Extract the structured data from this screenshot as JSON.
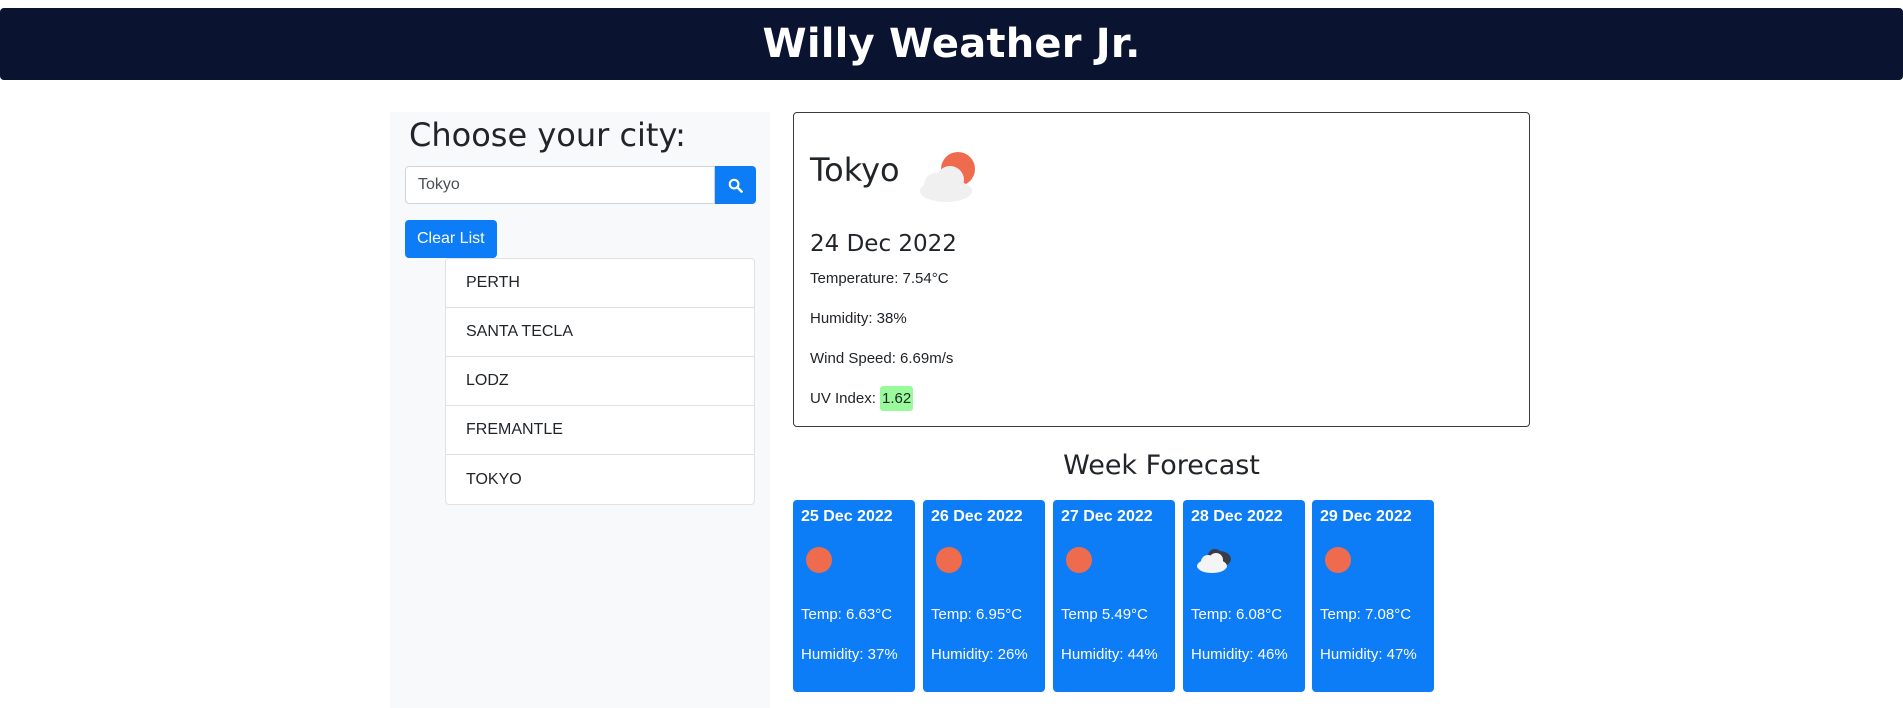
{
  "header": {
    "title": "Willy Weather Jr."
  },
  "sidebar": {
    "heading": "Choose your city:",
    "search": {
      "value": "Tokyo",
      "placeholder": "",
      "button_icon": "search-icon"
    },
    "clear_label": "Clear List",
    "cities": [
      "PERTH",
      "SANTA TECLA",
      "LODZ",
      "FREMANTLE",
      "TOKYO"
    ]
  },
  "current": {
    "city": "Tokyo",
    "icon": "sun-behind-cloud-icon",
    "date": "24 Dec 2022",
    "temperature": "Temperature: 7.54°C",
    "humidity": "Humidity: 38%",
    "wind": "Wind Speed: 6.69m/s",
    "uv_label": "UV Index: ",
    "uv_value": "1.62"
  },
  "forecast": {
    "title": "Week Forecast",
    "days": [
      {
        "date": "25 Dec 2022",
        "icon": "sun-icon",
        "temp": "Temp: 6.63°C",
        "humidity": "Humidity: 37%"
      },
      {
        "date": "26 Dec 2022",
        "icon": "sun-icon",
        "temp": "Temp: 6.95°C",
        "humidity": "Humidity: 26%"
      },
      {
        "date": "27 Dec 2022",
        "icon": "sun-icon",
        "temp": "Temp 5.49°C",
        "humidity": "Humidity: 44%"
      },
      {
        "date": "28 Dec 2022",
        "icon": "dark-cloud-icon",
        "temp": "Temp: 6.08°C",
        "humidity": "Humidity: 46%"
      },
      {
        "date": "29 Dec 2022",
        "icon": "sun-icon",
        "temp": "Temp: 7.08°C",
        "humidity": "Humidity: 47%"
      }
    ]
  },
  "colors": {
    "header_bg": "#0a1330",
    "primary": "#0d7cf7",
    "sun": "#ef6b4d",
    "uv_badge": "#98fa9a"
  }
}
